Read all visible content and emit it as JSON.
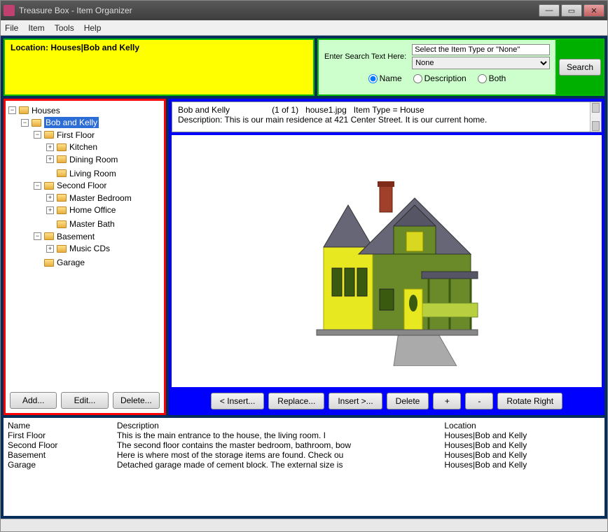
{
  "window": {
    "title": "Treasure Box - Item Organizer"
  },
  "menu": {
    "file": "File",
    "item": "Item",
    "tools": "Tools",
    "help": "Help"
  },
  "location": {
    "label": "Location: Houses|Bob and Kelly"
  },
  "search": {
    "label": "Enter Search Text Here:",
    "type_prompt": "Select the Item Type or \"None\"",
    "type_value": "None",
    "radio_name": "Name",
    "radio_desc": "Description",
    "radio_both": "Both",
    "button": "Search"
  },
  "tree": {
    "root": "Houses",
    "selected": "Bob and Kelly",
    "nodes": {
      "first_floor": "First Floor",
      "kitchen": "Kitchen",
      "dining_room": "Dining Room",
      "living_room": "Living Room",
      "second_floor": "Second Floor",
      "master_bedroom": "Master Bedroom",
      "home_office": "Home Office",
      "master_bath": "Master Bath",
      "basement": "Basement",
      "music_cds": "Music CDs",
      "garage": "Garage"
    },
    "buttons": {
      "add": "Add...",
      "edit": "Edit...",
      "delete": "Delete..."
    }
  },
  "detail": {
    "line1": "Bob and Kelly                  (1 of 1)   house1.jpg   Item Type = House",
    "line2": "Description:  This is our main residence at 421 Center Street. It is our current home."
  },
  "image_buttons": {
    "insert_left": "< Insert...",
    "replace": "Replace...",
    "insert_right": "Insert >...",
    "delete": "Delete",
    "plus": "+",
    "minus": "-",
    "rotate": "Rotate Right"
  },
  "grid": {
    "headers": {
      "name": "Name",
      "desc": "Description",
      "loc": "Location"
    },
    "rows": [
      {
        "name": "First Floor",
        "desc": "This is the main entrance to the house, the living room.  I",
        "loc": "Houses|Bob and Kelly"
      },
      {
        "name": "Second Floor",
        "desc": "The second floor contains the master bedroom, bathroom, bow",
        "loc": "Houses|Bob and Kelly"
      },
      {
        "name": "Basement",
        "desc": "Here is where most of the storage items are found. Check ou",
        "loc": "Houses|Bob and Kelly"
      },
      {
        "name": "Garage",
        "desc": "Detached garage made of cement block.  The external size is",
        "loc": "Houses|Bob and Kelly"
      }
    ]
  }
}
